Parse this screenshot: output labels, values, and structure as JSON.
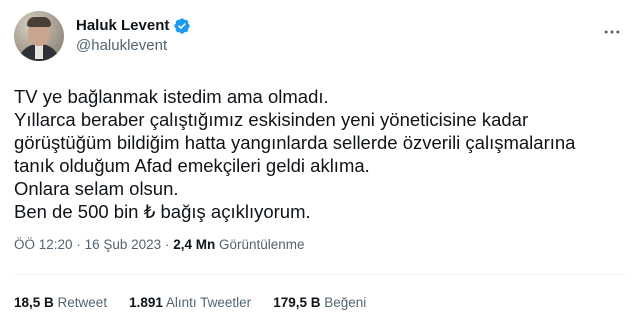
{
  "author": {
    "display_name": "Haluk Levent",
    "handle": "@haluklevent",
    "verified_color": "#1d9bf0"
  },
  "tweet": {
    "lines": [
      "TV ye bağlanmak istedim ama olmadı.",
      "Yıllarca beraber çalıştığımız eskisinden yeni yöneticisine kadar",
      "görüştüğüm bildiğim hatta yangınlarda sellerde özverili çalışmalarına",
      "tanık olduğum Afad emekçileri geldi aklıma.",
      "Onlara selam olsun.",
      "Ben de 500 bin ₺ bağış açıklıyorum."
    ]
  },
  "meta": {
    "time": "ÖÖ 12:20",
    "separator": "·",
    "date": "16 Şub 2023",
    "views_count": "2,4 Mn",
    "views_label": "Görüntülenme"
  },
  "stats": {
    "retweets_count": "18,5 B",
    "retweets_label": "Retweet",
    "quotes_count": "1.891",
    "quotes_label": "Alıntı Tweetler",
    "likes_count": "179,5 B",
    "likes_label": "Beğeni"
  },
  "icons": {
    "verified": "verified-badge-icon",
    "more": "more-options-icon"
  }
}
